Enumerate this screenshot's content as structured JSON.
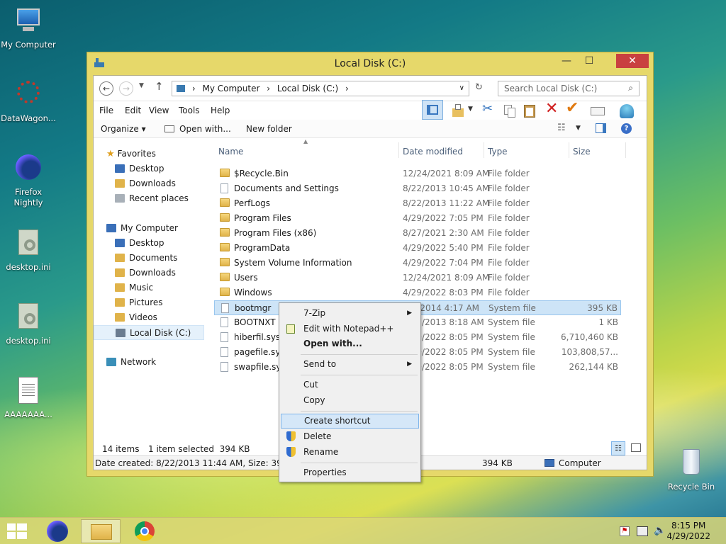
{
  "desktop": {
    "icons": [
      {
        "label": "My Computer"
      },
      {
        "label": "DataWagon..."
      },
      {
        "label": "Firefox Nightly"
      },
      {
        "label": "desktop.ini"
      },
      {
        "label": "desktop.ini"
      },
      {
        "label": "AAAAAAA..."
      },
      {
        "label": "Recycle Bin"
      }
    ]
  },
  "window": {
    "title": "Local Disk (C:)",
    "close_symbol": "✕",
    "min_symbol": "—",
    "max_symbol": "☐",
    "address": {
      "segments": [
        "My Computer",
        "Local Disk (C:)"
      ]
    },
    "search_placeholder": "Search Local Disk (C:)",
    "menu": [
      "File",
      "Edit",
      "View",
      "Tools",
      "Help"
    ],
    "commands": {
      "organize": "Organize ▾",
      "open_with": "Open with...",
      "new_folder": "New folder"
    },
    "nav": {
      "favorites": "Favorites",
      "fav_items": [
        "Desktop",
        "Downloads",
        "Recent places"
      ],
      "computer": "My Computer",
      "comp_items": [
        "Desktop",
        "Documents",
        "Downloads",
        "Music",
        "Pictures",
        "Videos",
        "Local Disk (C:)"
      ],
      "network": "Network"
    },
    "columns": [
      "Name",
      "Date modified",
      "Type",
      "Size"
    ],
    "files": [
      {
        "name": "$Recycle.Bin",
        "date": "12/24/2021 8:09 AM",
        "type": "File folder",
        "size": "",
        "kind": "folder"
      },
      {
        "name": "Documents and Settings",
        "date": "8/22/2013 10:45 AM",
        "type": "File folder",
        "size": "",
        "kind": "link"
      },
      {
        "name": "PerfLogs",
        "date": "8/22/2013 11:22 AM",
        "type": "File folder",
        "size": "",
        "kind": "folder"
      },
      {
        "name": "Program Files",
        "date": "4/29/2022 7:05 PM",
        "type": "File folder",
        "size": "",
        "kind": "folder"
      },
      {
        "name": "Program Files (x86)",
        "date": "8/27/2021 2:30 AM",
        "type": "File folder",
        "size": "",
        "kind": "folder"
      },
      {
        "name": "ProgramData",
        "date": "4/29/2022 5:40 PM",
        "type": "File folder",
        "size": "",
        "kind": "folder"
      },
      {
        "name": "System Volume Information",
        "date": "4/29/2022 7:04 PM",
        "type": "File folder",
        "size": "",
        "kind": "folder"
      },
      {
        "name": "Users",
        "date": "12/24/2021 8:09 AM",
        "type": "File folder",
        "size": "",
        "kind": "folder"
      },
      {
        "name": "Windows",
        "date": "4/29/2022 8:03 PM",
        "type": "File folder",
        "size": "",
        "kind": "folder"
      },
      {
        "name": "bootmgr",
        "date": "3/1/2014 4:17 AM",
        "type": "System file",
        "size": "395 KB",
        "kind": "file",
        "selected": true
      },
      {
        "name": "BOOTNXT",
        "date": "8/22/2013 8:18 AM",
        "type": "System file",
        "size": "1 KB",
        "kind": "file"
      },
      {
        "name": "hiberfil.sys",
        "date": "4/29/2022 8:05 PM",
        "type": "System file",
        "size": "6,710,460 KB",
        "kind": "file"
      },
      {
        "name": "pagefile.sys",
        "date": "4/29/2022 8:05 PM",
        "type": "System file",
        "size": "103,808,57...",
        "kind": "file"
      },
      {
        "name": "swapfile.sys",
        "date": "4/29/2022 8:05 PM",
        "type": "System file",
        "size": "262,144 KB",
        "kind": "file"
      }
    ],
    "status": {
      "count": "14 items",
      "selected": "1 item selected  394 KB",
      "details": "Date created: 8/22/2013 11:44 AM, Size: 394 KB",
      "size": "394 KB",
      "location": "Computer"
    }
  },
  "context_menu": {
    "items": [
      {
        "label": "7-Zip",
        "submenu": true
      },
      {
        "label": "Edit with Notepad++"
      },
      {
        "label": "Open with..."
      },
      {
        "label": "Send to",
        "submenu": true
      },
      {
        "label": "Cut"
      },
      {
        "label": "Copy"
      },
      {
        "label": "Create shortcut"
      },
      {
        "label": "Delete"
      },
      {
        "label": "Rename"
      },
      {
        "label": "Properties"
      }
    ],
    "arrow": "▶"
  },
  "taskbar": {
    "time": "8:15 PM",
    "date": "4/29/2022"
  },
  "colors": {
    "window_frame": "#e6d86a",
    "close_button": "#c94040",
    "selection": "#cde4f7",
    "menu_highlight": "#d5e7f8"
  }
}
